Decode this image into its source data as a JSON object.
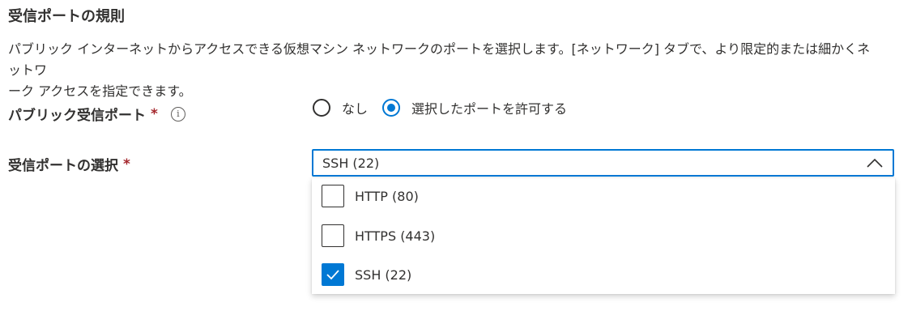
{
  "section": {
    "title": "受信ポートの規則",
    "description_line1": "パブリック インターネットからアクセスできる仮想マシン ネットワークのポートを選択します。[ネットワーク] タブで、より限定的または細かくネットワ",
    "description_line2": "ーク アクセスを指定できます。"
  },
  "public_inbound": {
    "label": "パブリック受信ポート",
    "required_mark": "*",
    "info_icon": "info-icon",
    "info_glyph": "i",
    "options": [
      {
        "label": "なし",
        "selected": false
      },
      {
        "label": "選択したポートを許可する",
        "selected": true
      }
    ]
  },
  "inbound_ports": {
    "label": "受信ポートの選択",
    "required_mark": "*",
    "selected_value": "SSH (22)",
    "chevron_icon": "chevron-up-icon",
    "options": [
      {
        "label": "HTTP (80)",
        "checked": false
      },
      {
        "label": "HTTPS (443)",
        "checked": false
      },
      {
        "label": "SSH (22)",
        "checked": true
      }
    ]
  },
  "colors": {
    "accent": "#0078d4",
    "required": "#a4262c",
    "text": "#323130"
  }
}
